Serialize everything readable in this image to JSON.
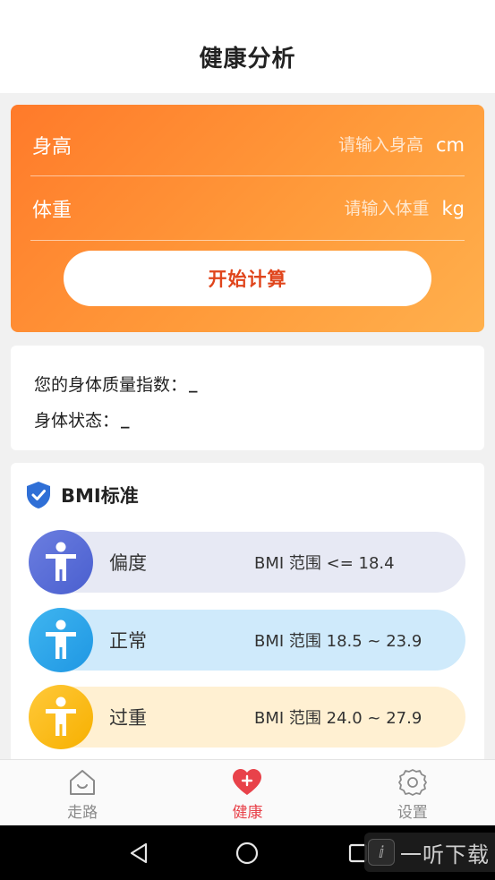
{
  "header": {
    "title": "健康分析"
  },
  "calculator": {
    "height_label": "身高",
    "height_placeholder": "请输入身高",
    "height_value": "",
    "height_unit": "cm",
    "weight_label": "体重",
    "weight_placeholder": "请输入体重",
    "weight_value": "",
    "weight_unit": "kg",
    "button_label": "开始计算",
    "gradient_start": "#ff7a2a",
    "gradient_end": "#ffb04d",
    "button_text_color": "#e0451c"
  },
  "result": {
    "bmi_label": "您的身体质量指数：",
    "bmi_value": "_",
    "status_label": "身体状态：",
    "status_value": "_"
  },
  "bmi_standard": {
    "title": "BMI标准",
    "icon": "shield-check-icon",
    "levels": [
      {
        "name": "偏度",
        "range": "BMI 范围 <= 18.4",
        "color": "#5568d6",
        "bg": "#e7e9f4",
        "icon": "person-icon"
      },
      {
        "name": "正常",
        "range": "BMI 范围 18.5 ~ 23.9",
        "color": "#2aa6ea",
        "bg": "#cfeafb",
        "icon": "person-icon"
      },
      {
        "name": "过重",
        "range": "BMI 范围 24.0 ~ 27.9",
        "color": "#f9bd1a",
        "bg": "#fff0d2",
        "icon": "person-icon"
      }
    ]
  },
  "tabs": [
    {
      "label": "走路",
      "icon": "home-smile-icon",
      "active": false
    },
    {
      "label": "健康",
      "icon": "heart-plus-icon",
      "active": true
    },
    {
      "label": "设置",
      "icon": "gear-icon",
      "active": false
    }
  ],
  "android_nav": {
    "back": "back-triangle-icon",
    "home": "home-circle-icon",
    "recents": "recents-square-icon"
  },
  "watermark": {
    "text": "一听下载"
  }
}
